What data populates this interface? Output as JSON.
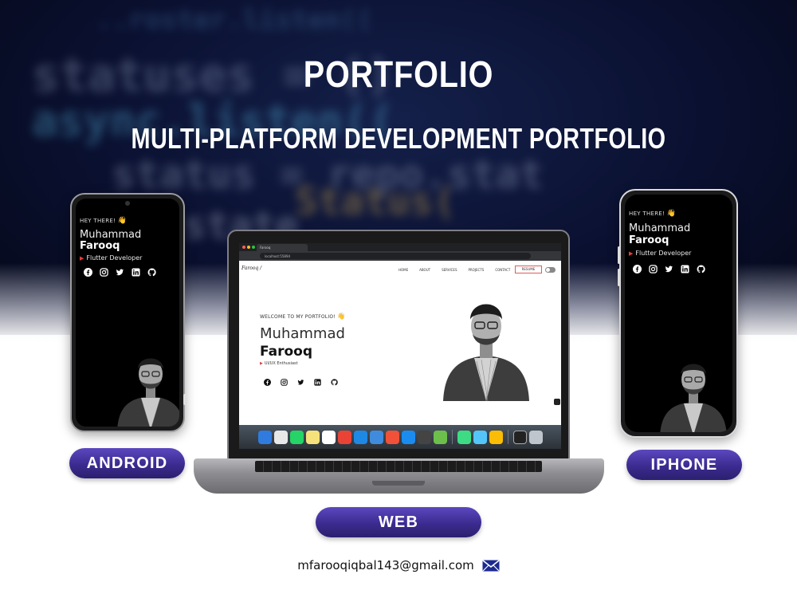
{
  "header": {
    "title": "PORTFOLIO",
    "subtitle": "MULTI-PLATFORM DEVELOPMENT PORTFOLIO"
  },
  "background_code_lines": [
    "statuses = ()",
    "async.listen((",
    "status = repo.stat",
    "state",
    "..roster.listen((",
    "Status("
  ],
  "android": {
    "greeting": "HEY THERE!",
    "first_name": "Muhammad",
    "last_name": "Farooq",
    "role": "Flutter Developer",
    "label": "ANDROID"
  },
  "iphone": {
    "greeting": "HEY THERE!",
    "first_name": "Muhammad",
    "last_name": "Farooq",
    "role": "Flutter Developer",
    "label": "IPHONE"
  },
  "web": {
    "label": "WEB",
    "browser_tab": "Farooq",
    "url": "localhost:55894",
    "logo": "Farooq /",
    "nav": [
      "HOME",
      "ABOUT",
      "SERVICES",
      "PROJECTS",
      "CONTACT"
    ],
    "resume": "RESUME",
    "greeting": "WELCOME TO MY PORTFOLIO!",
    "first_name": "Muhammad",
    "last_name": "Farooq",
    "role": "UI/UX Enthusiast"
  },
  "social_icons": [
    "facebook-icon",
    "instagram-icon",
    "twitter-icon",
    "linkedin-icon",
    "github-icon"
  ],
  "dock_apps": [
    "finder-icon",
    "launchpad-icon",
    "whatsapp-icon",
    "notes-icon",
    "slack-icon",
    "chrome-icon",
    "vscode-icon",
    "xcode-icon",
    "swift-icon",
    "safari-icon",
    "terminal-icon",
    "android-studio-icon",
    "android-icon",
    "flutter-icon",
    "chrome-icon",
    "screen-icon",
    "trash-icon"
  ],
  "contact": {
    "email": "mfarooqiqbal143@gmail.com"
  },
  "colors": {
    "button_gradient_top": "#5b48c0",
    "button_gradient_bottom": "#2a1f6e",
    "background_dark": "#0a1030",
    "accent_red": "#e63e3e"
  }
}
